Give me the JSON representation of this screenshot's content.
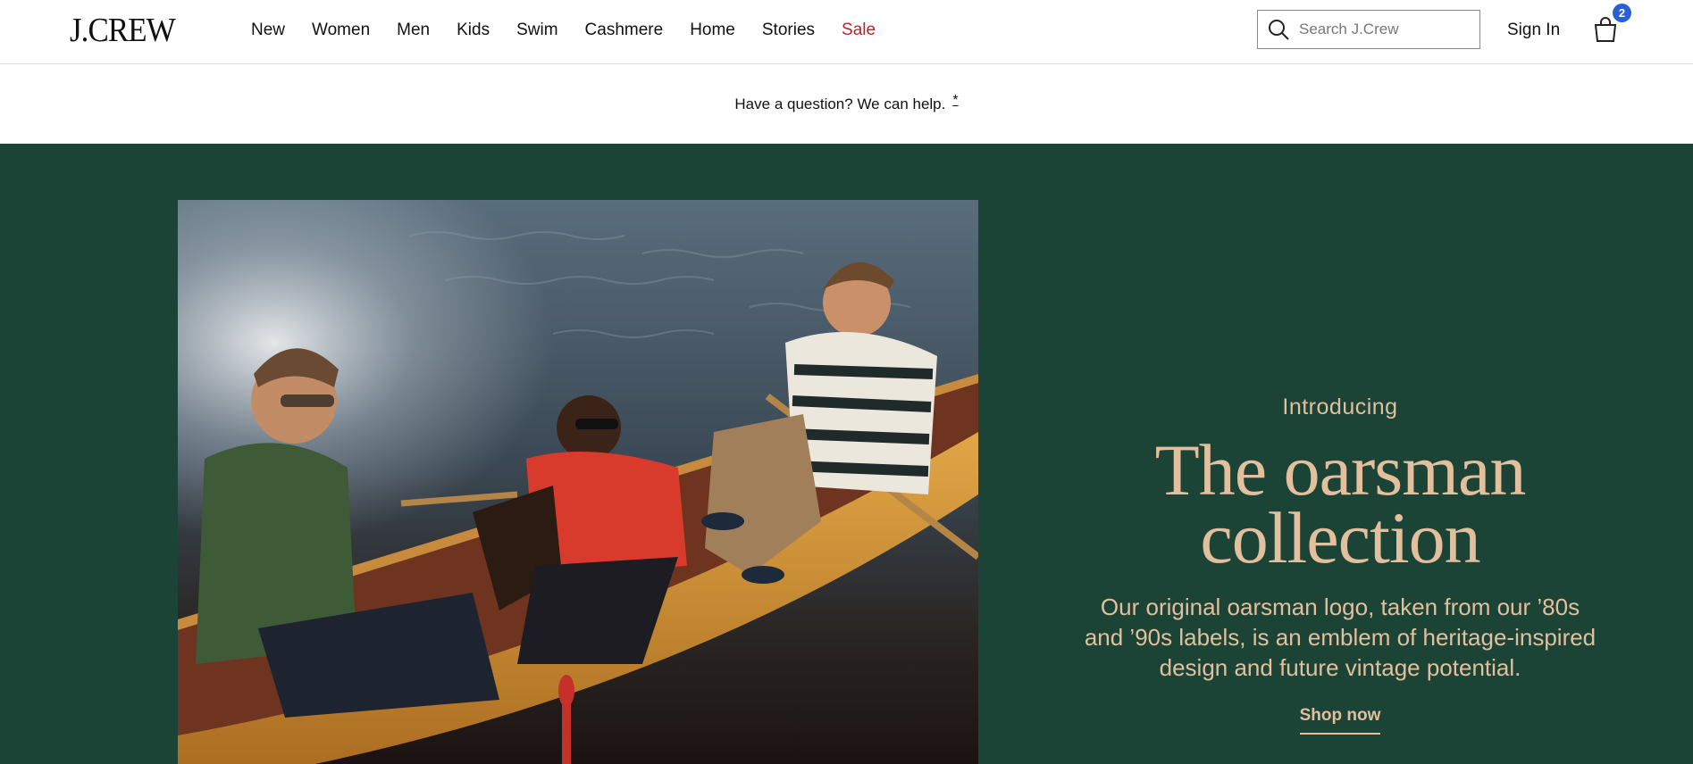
{
  "brand": {
    "logo": "J.CREW"
  },
  "nav": {
    "items": [
      {
        "label": "New"
      },
      {
        "label": "Women"
      },
      {
        "label": "Men"
      },
      {
        "label": "Kids"
      },
      {
        "label": "Swim"
      },
      {
        "label": "Cashmere"
      },
      {
        "label": "Home"
      },
      {
        "label": "Stories"
      },
      {
        "label": "Sale"
      }
    ]
  },
  "search": {
    "placeholder": "Search J.Crew"
  },
  "account": {
    "sign_in": "Sign In"
  },
  "bag": {
    "count": "2"
  },
  "help_banner": {
    "text": "Have a question? We can help.",
    "marker": "*"
  },
  "hero": {
    "intro": "Introducing",
    "title_line1": "The oarsman",
    "title_line2": "collection",
    "description": "Our original oarsman logo, taken from our ’80s and ’90s labels, is an emblem of heritage-inspired design and future vintage potential.",
    "cta": "Shop now"
  },
  "colors": {
    "hero_bg": "#1b4437",
    "hero_text": "#e2bf9d",
    "sale": "#b3262d",
    "badge": "#2a5fd9"
  }
}
